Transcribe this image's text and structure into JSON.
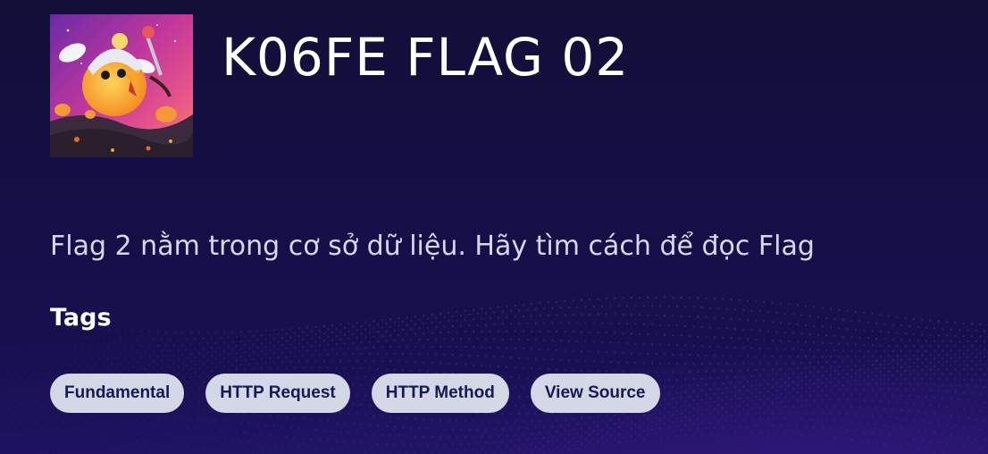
{
  "challenge": {
    "title": "K06FE FLAG 02",
    "description": "Flag 2 nằm trong cơ sở dữ liệu. Hãy tìm cách để đọc Flag",
    "image_icon": "chicken-astronaut-illustration"
  },
  "tags_section": {
    "heading": "Tags",
    "tags": [
      {
        "label": "Fundamental"
      },
      {
        "label": "HTTP Request"
      },
      {
        "label": "HTTP Method"
      },
      {
        "label": "View Source"
      }
    ]
  },
  "colors": {
    "background": "#140f45",
    "tag_background": "#d3d7e6",
    "tag_text": "#141a55",
    "description_text": "#d9d6ea"
  }
}
